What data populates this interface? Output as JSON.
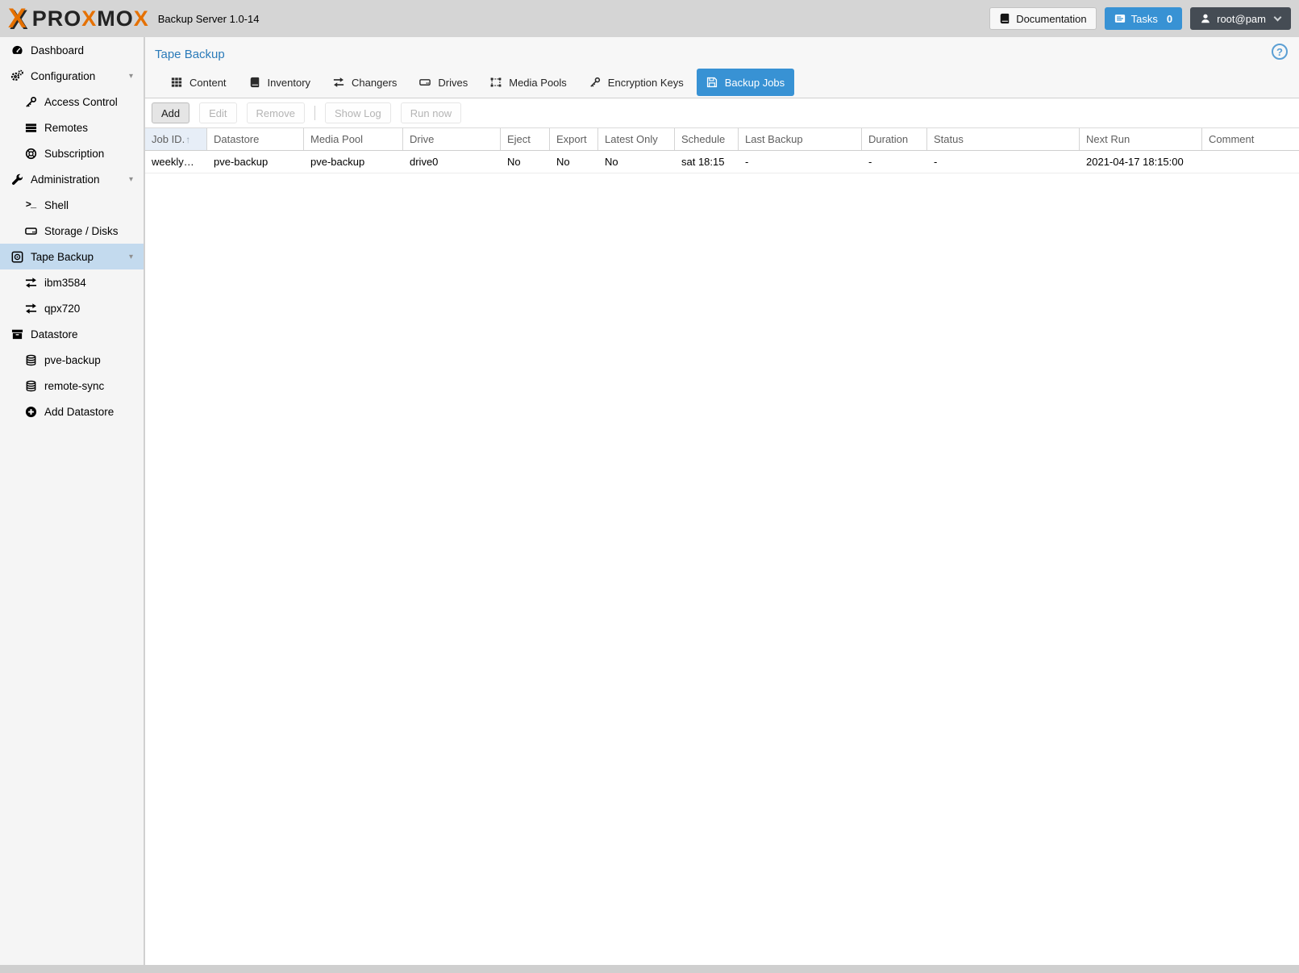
{
  "colors": {
    "accent_blue": "#3892d4",
    "title_blue": "#2b7bb9",
    "sidebar_selection": "#c3daee",
    "topbar_bg": "#d5d5d5",
    "user_button_bg": "#454c54",
    "sorted_column_bg": "#e7eef7",
    "logo_orange": "#e57000"
  },
  "icons": {
    "caret_down": "▾",
    "help": "?",
    "shell": ">_",
    "sort_asc": "↑"
  },
  "topbar": {
    "brand": {
      "mark": "X",
      "p1": "PRO",
      "o1": "X",
      "p2": "MO",
      "o2": "X"
    },
    "product": "Backup Server 1.0-14",
    "documentation": "Documentation",
    "tasks": "Tasks",
    "tasks_count": "0",
    "user": "root@pam"
  },
  "sidebar": {
    "items": [
      {
        "label": "Dashboard",
        "icon": "tachometer-icon",
        "level": 0
      },
      {
        "label": "Configuration",
        "icon": "gears-icon",
        "level": 0,
        "expanded": true
      },
      {
        "label": "Access Control",
        "icon": "key-icon",
        "level": 1
      },
      {
        "label": "Remotes",
        "icon": "server-list-icon",
        "level": 1
      },
      {
        "label": "Subscription",
        "icon": "life-ring-icon",
        "level": 1
      },
      {
        "label": "Administration",
        "icon": "wrench-icon",
        "level": 0,
        "expanded": true
      },
      {
        "label": "Shell",
        "icon": "terminal-icon",
        "level": 1
      },
      {
        "label": "Storage / Disks",
        "icon": "hdd-icon",
        "level": 1
      },
      {
        "label": "Tape Backup",
        "icon": "tape-icon",
        "level": 0,
        "expanded": true,
        "selected": true
      },
      {
        "label": "ibm3584",
        "icon": "exchange-icon",
        "level": 1
      },
      {
        "label": "qpx720",
        "icon": "exchange-icon",
        "level": 1
      },
      {
        "label": "Datastore",
        "icon": "archive-icon",
        "level": 0
      },
      {
        "label": "pve-backup",
        "icon": "database-icon",
        "level": 1
      },
      {
        "label": "remote-sync",
        "icon": "database-icon",
        "level": 1
      },
      {
        "label": "Add Datastore",
        "icon": "plus-circle-icon",
        "level": 1
      }
    ]
  },
  "content": {
    "title": "Tape Backup",
    "tabs": [
      {
        "label": "Content",
        "icon": "grid-icon"
      },
      {
        "label": "Inventory",
        "icon": "book-icon"
      },
      {
        "label": "Changers",
        "icon": "exchange-icon"
      },
      {
        "label": "Drives",
        "icon": "hdd-icon"
      },
      {
        "label": "Media Pools",
        "icon": "object-group-icon"
      },
      {
        "label": "Encryption Keys",
        "icon": "key-icon"
      },
      {
        "label": "Backup Jobs",
        "icon": "save-icon",
        "active": true
      }
    ],
    "toolbar": [
      {
        "label": "Add",
        "enabled": true
      },
      {
        "label": "Edit",
        "enabled": false
      },
      {
        "label": "Remove",
        "enabled": false
      },
      {
        "label": "Show Log",
        "enabled": false
      },
      {
        "label": "Run now",
        "enabled": false
      }
    ],
    "table": {
      "sort_icon": "↑",
      "columns": [
        {
          "label": "Job ID.",
          "sorted": "asc"
        },
        {
          "label": "Datastore"
        },
        {
          "label": "Media Pool"
        },
        {
          "label": "Drive"
        },
        {
          "label": "Eject"
        },
        {
          "label": "Export"
        },
        {
          "label": "Latest Only"
        },
        {
          "label": "Schedule"
        },
        {
          "label": "Last Backup"
        },
        {
          "label": "Duration"
        },
        {
          "label": "Status"
        },
        {
          "label": "Next Run"
        },
        {
          "label": "Comment"
        }
      ],
      "rows": [
        {
          "cells": [
            "weekly…",
            "pve-backup",
            "pve-backup",
            "drive0",
            "No",
            "No",
            "No",
            "sat 18:15",
            "-",
            "-",
            "-",
            "2021-04-17 18:15:00",
            ""
          ]
        }
      ]
    }
  }
}
